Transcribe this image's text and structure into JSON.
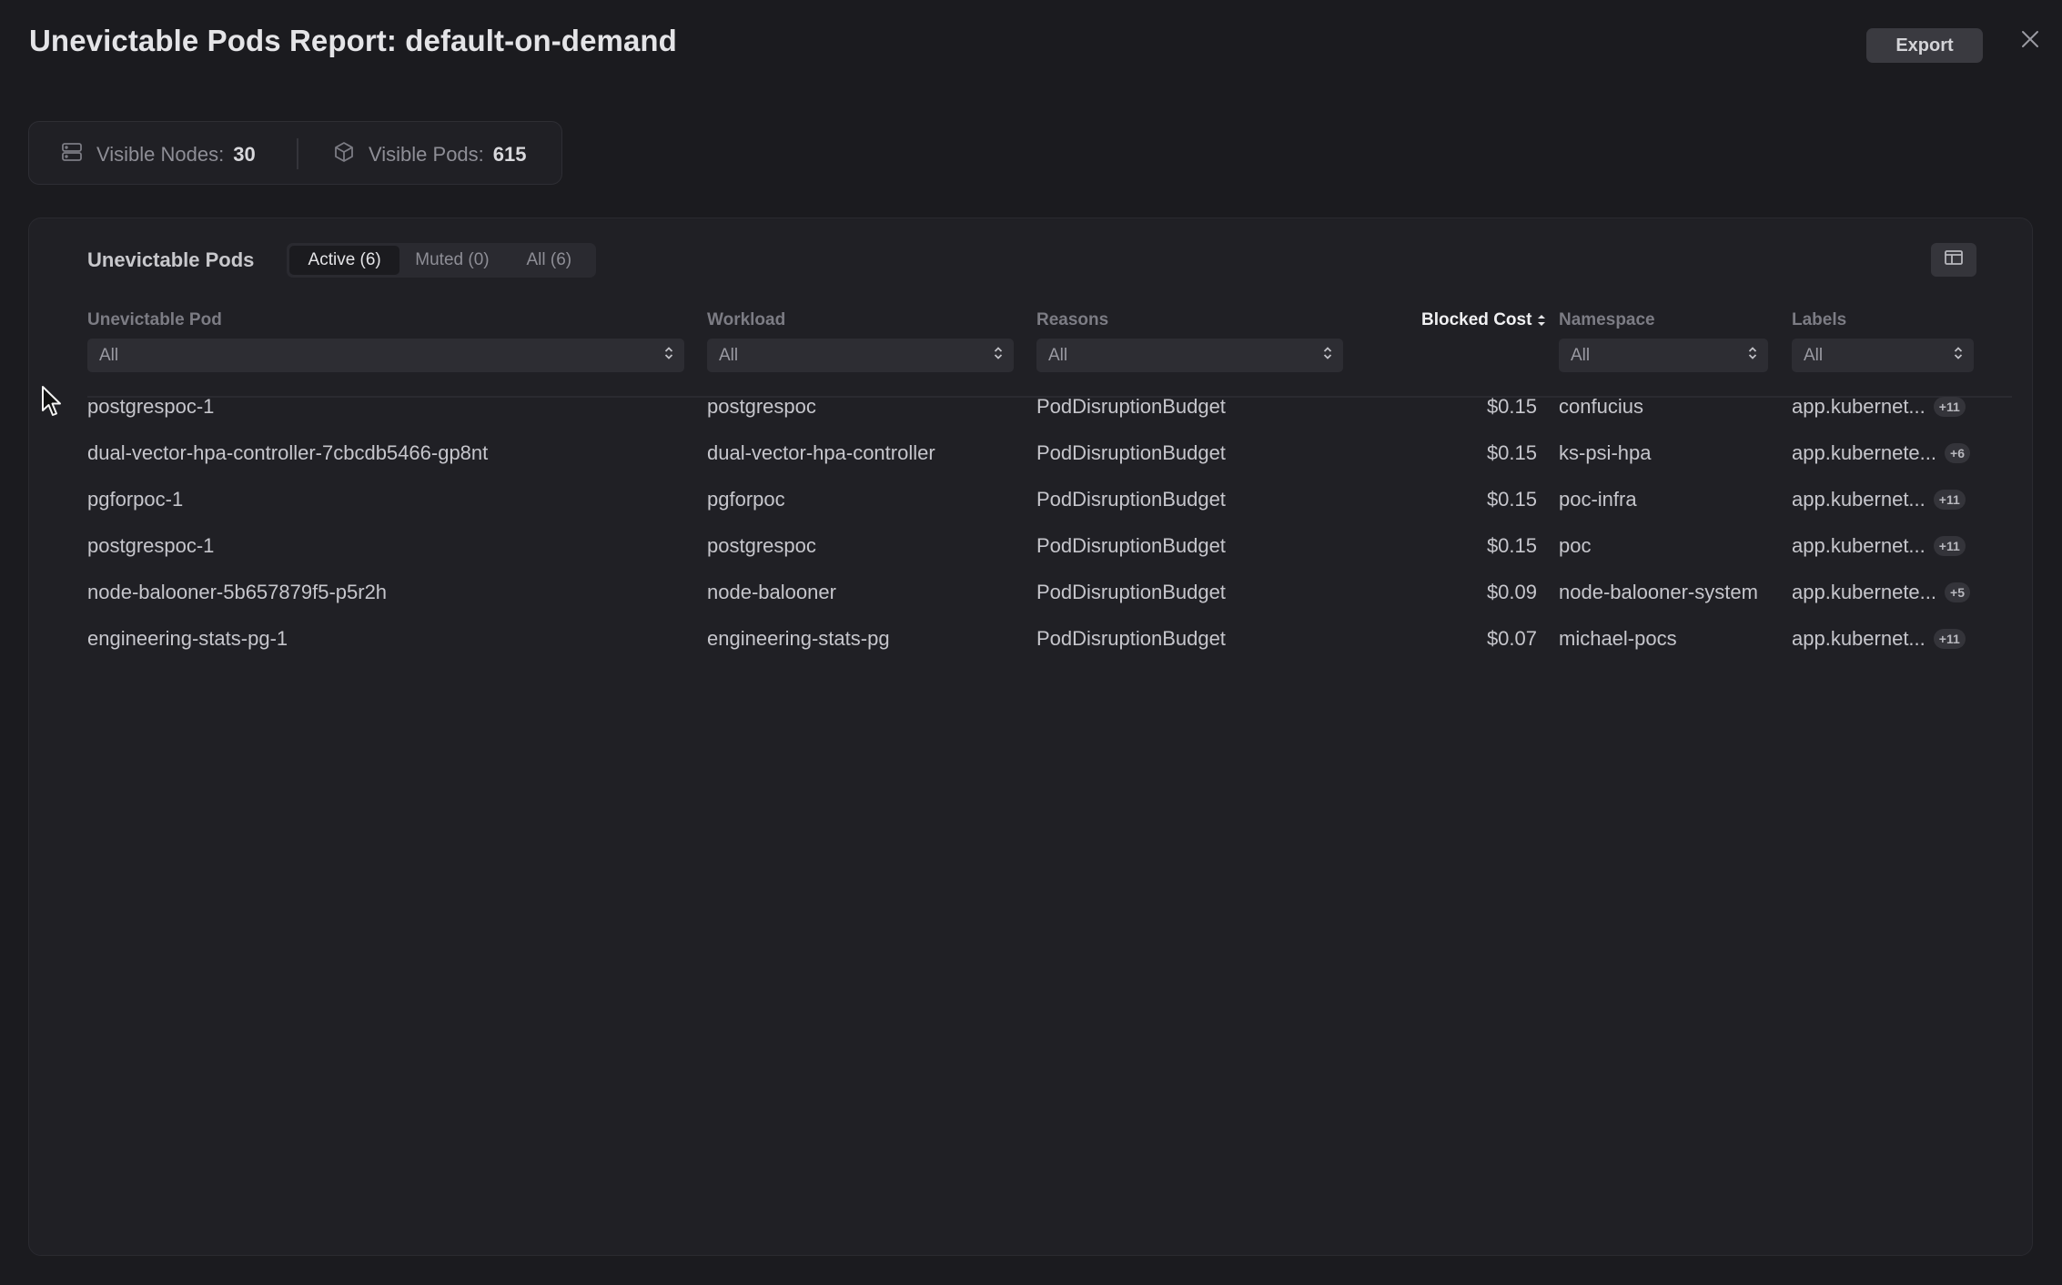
{
  "header": {
    "title": "Unevictable Pods Report: default-on-demand",
    "export_label": "Export"
  },
  "stats": {
    "nodes_label": "Visible Nodes:",
    "nodes_value": "30",
    "pods_label": "Visible Pods:",
    "pods_value": "615"
  },
  "panel": {
    "title": "Unevictable Pods",
    "tabs": [
      {
        "label": "Active (6)",
        "active": true
      },
      {
        "label": "Muted (0)",
        "active": false
      },
      {
        "label": "All (6)",
        "active": false
      }
    ]
  },
  "columns": {
    "pod": "Unevictable Pod",
    "workload": "Workload",
    "reasons": "Reasons",
    "cost": "Blocked Cost",
    "namespace": "Namespace",
    "labels": "Labels"
  },
  "filters": {
    "pod": "All",
    "workload": "All",
    "reasons": "All",
    "namespace": "All",
    "labels": "All"
  },
  "rows": [
    {
      "pod": "postgrespoc-1",
      "workload": "postgrespoc",
      "reason": "PodDisruptionBudget",
      "cost": "$0.15",
      "namespace": "confucius",
      "label": "app.kubernet...",
      "badge": "+11"
    },
    {
      "pod": "dual-vector-hpa-controller-7cbcdb5466-gp8nt",
      "workload": "dual-vector-hpa-controller",
      "reason": "PodDisruptionBudget",
      "cost": "$0.15",
      "namespace": "ks-psi-hpa",
      "label": "app.kubernete...",
      "badge": "+6"
    },
    {
      "pod": "pgforpoc-1",
      "workload": "pgforpoc",
      "reason": "PodDisruptionBudget",
      "cost": "$0.15",
      "namespace": "poc-infra",
      "label": "app.kubernet...",
      "badge": "+11"
    },
    {
      "pod": "postgrespoc-1",
      "workload": "postgrespoc",
      "reason": "PodDisruptionBudget",
      "cost": "$0.15",
      "namespace": "poc",
      "label": "app.kubernet...",
      "badge": "+11"
    },
    {
      "pod": "node-balooner-5b657879f5-p5r2h",
      "workload": "node-balooner",
      "reason": "PodDisruptionBudget",
      "cost": "$0.09",
      "namespace": "node-balooner-system",
      "label": "app.kubernete...",
      "badge": "+5"
    },
    {
      "pod": "engineering-stats-pg-1",
      "workload": "engineering-stats-pg",
      "reason": "PodDisruptionBudget",
      "cost": "$0.07",
      "namespace": "michael-pocs",
      "label": "app.kubernet...",
      "badge": "+11"
    }
  ]
}
